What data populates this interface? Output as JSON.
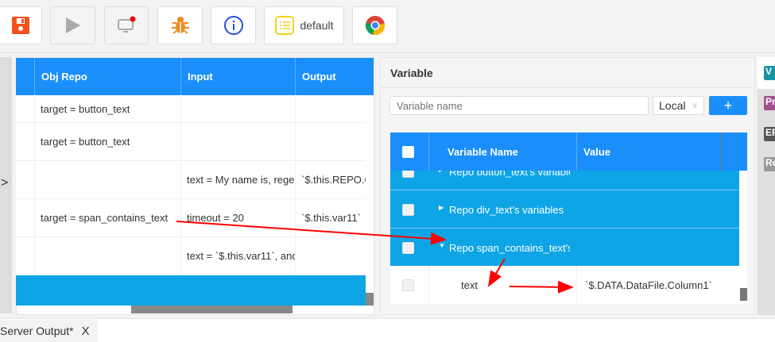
{
  "toolbar": {
    "buttons": [
      {
        "icon": "save-icon"
      },
      {
        "icon": "play-icon"
      },
      {
        "icon": "monitor-icon"
      },
      {
        "icon": "bug-icon"
      },
      {
        "icon": "info-icon"
      },
      {
        "icon": "list-icon",
        "label": "default"
      },
      {
        "icon": "chrome-icon"
      }
    ]
  },
  "steps_table": {
    "columns": [
      "Obj Repo",
      "Input",
      "Output"
    ],
    "rows": [
      {
        "obj": "target = button_text",
        "input": "",
        "output": ""
      },
      {
        "obj": "target = button_text",
        "input": "",
        "output": ""
      },
      {
        "obj": "",
        "input": "text = My name is, rege",
        "output": "`$.this.REPO.Ce"
      },
      {
        "obj": "target = span_contains_text",
        "input": "timeout = 20",
        "output": "`$.this.var11`"
      },
      {
        "obj": "",
        "input": "text = `$.this.var11`, and",
        "output": ""
      }
    ]
  },
  "variable_panel": {
    "title": "Variable",
    "search_placeholder": "Variable name",
    "scope": "Local",
    "add_label": "+",
    "columns": [
      "Variable Name",
      "Value"
    ],
    "groups": [
      "Repo button_text's variables",
      "Repo div_text's variables",
      "Repo span_contains_text's va"
    ],
    "child": {
      "name": "text",
      "value": "`$.DATA.DataFile.Column1`"
    }
  },
  "side_tabs": [
    {
      "label": "V",
      "color": "#1793a6"
    },
    {
      "label": "Pr",
      "color": "#a0528e"
    },
    {
      "label": "EP",
      "color": "#555555"
    },
    {
      "label": "Re",
      "color": "#999999"
    }
  ],
  "bottom_tab": {
    "label": "Server Output*",
    "close": "X"
  },
  "colors": {
    "header": "#1a8ffc",
    "row_selected": "#0ea5e6",
    "annotation": "#ff0000"
  }
}
